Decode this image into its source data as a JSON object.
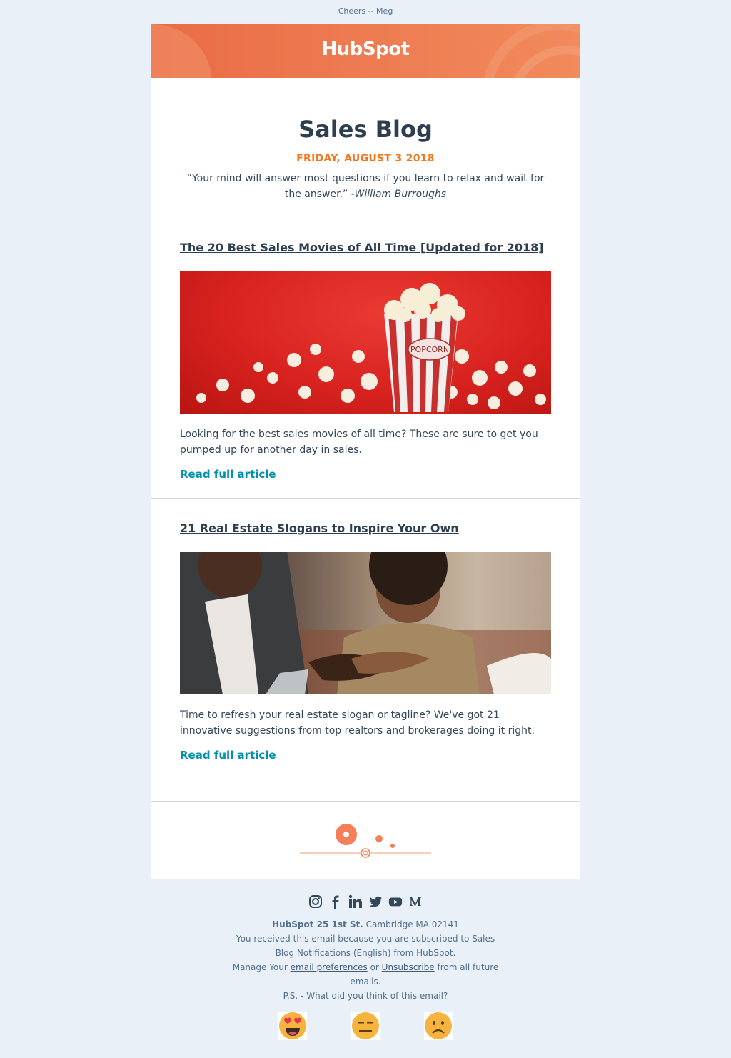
{
  "preheader": "Cheers -- Meg",
  "header": {
    "logo_text": "HubSpot",
    "brand_color": "#ff7a59"
  },
  "intro": {
    "title": "Sales Blog",
    "date": "FRIDAY, AUGUST 3 2018",
    "quote": "“Your mind will answer most questions if you learn to relax and wait for the answer.”",
    "quote_author": "-William Burroughs"
  },
  "articles": [
    {
      "title": "The 20 Best Sales Movies of All Time [Updated for 2018]",
      "image_label": "POPCORN",
      "description": "Looking for the best sales movies of all time? These are sure to get you pumped up for another day in sales.",
      "link": "Read full article"
    },
    {
      "title": "21 Real Estate Slogans to Inspire Your Own",
      "description": "Time to refresh your real estate slogan or tagline? We've got 21 innovative suggestions from top realtors and brokerages doing it right.",
      "link": "Read full article"
    }
  ],
  "social_icons": [
    "instagram-icon",
    "facebook-icon",
    "linkedin-icon",
    "twitter-icon",
    "youtube-icon",
    "medium-icon"
  ],
  "footer": {
    "company": "HubSpot 25 1st St.",
    "city": "Cambridge MA 02141",
    "subscribed": "You received this email because you are subscribed to Sales Blog Notifications (English) from HubSpot.",
    "manage_prefix": "Manage Your",
    "prefs_link": "email preferences",
    "or": "or",
    "unsub_link": "Unsubscribe",
    "manage_suffix": "from all future emails.",
    "ps": "P.S. - What did you think of this email?"
  },
  "feedback": [
    "love-emoji",
    "neutral-emoji",
    "sad-emoji"
  ]
}
